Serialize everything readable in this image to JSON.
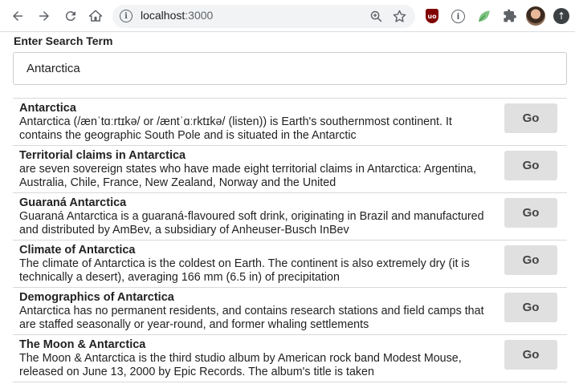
{
  "browser": {
    "url_host": "localhost",
    "url_port": ":3000",
    "extensions": {
      "ublock_label": "uo",
      "info_label": "i"
    }
  },
  "page": {
    "search_label": "Enter Search Term",
    "search_value": "Antarctica",
    "button_label": "Go",
    "results": [
      {
        "title": "Antarctica",
        "snippet": "Antarctica (/ænˈtɑːrtɪkə/ or /æntˈɑːrktɪkə/ (listen)) is Earth's southernmost continent. It contains the geographic South Pole and is situated in the Antarctic"
      },
      {
        "title": "Territorial claims in Antarctica",
        "snippet": "are seven sovereign states who have made eight territorial claims in Antarctica: Argentina, Australia, Chile, France, New Zealand, Norway and the United"
      },
      {
        "title": "Guaraná Antarctica",
        "snippet": "Guaraná Antarctica is a guaraná-flavoured soft drink, originating in Brazil and manufactured and distributed by AmBev, a subsidiary of Anheuser-Busch InBev"
      },
      {
        "title": "Climate of Antarctica",
        "snippet": "The climate of Antarctica is the coldest on Earth. The continent is also extremely dry (it is technically a desert), averaging 166 mm (6.5 in) of precipitation"
      },
      {
        "title": "Demographics of Antarctica",
        "snippet": "Antarctica has no permanent residents, and contains research stations and field camps that are staffed seasonally or year-round, and former whaling settlements"
      },
      {
        "title": "The Moon & Antarctica",
        "snippet": "The Moon & Antarctica is the third studio album by American rock band Modest Mouse, released on June 13, 2000 by Epic Records. The album's title is taken"
      }
    ]
  }
}
